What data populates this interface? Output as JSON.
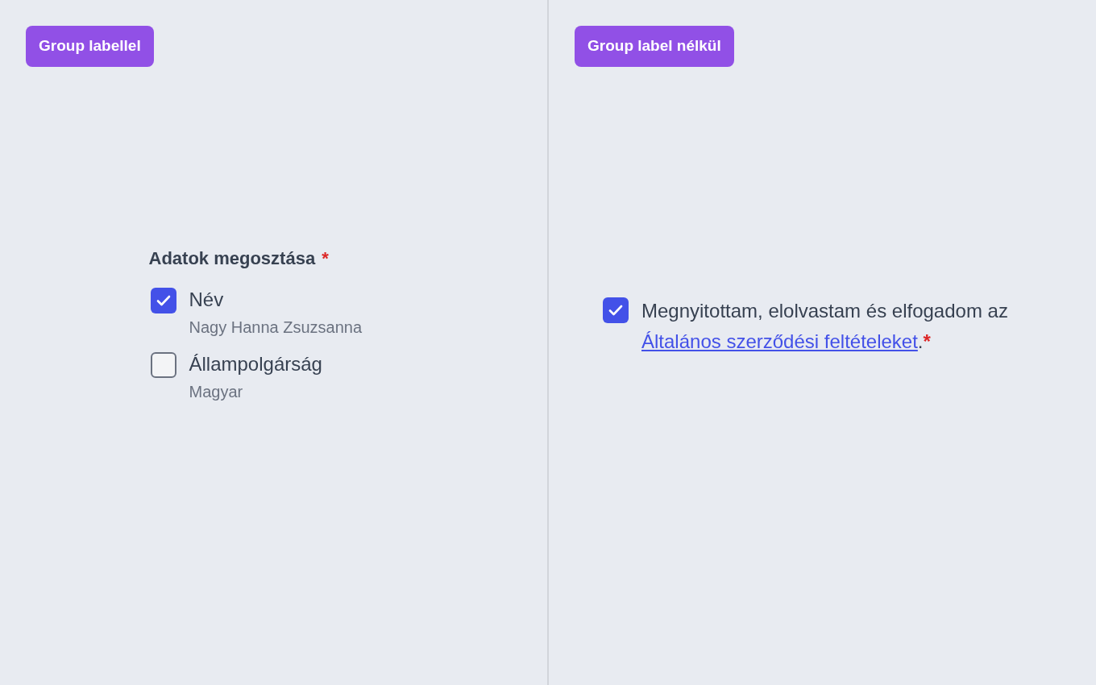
{
  "panels": [
    {
      "badge": "Group labellel",
      "kind": "group",
      "group": {
        "label": "Adatok megosztása",
        "required_mark": "*",
        "options": [
          {
            "label": "Név",
            "description": "Nagy Hanna Zsuzsanna",
            "checked": true
          },
          {
            "label": "Állampolgárság",
            "description": "Magyar",
            "checked": false
          }
        ]
      }
    },
    {
      "badge": "Group label nélkül",
      "kind": "single",
      "consent": {
        "checked": true,
        "text_before": "Megnyitottam, elolvastam és elfogadom az",
        "link": "Általános szerződési feltételeket",
        "text_after": ".",
        "required_mark": "*"
      }
    }
  ]
}
